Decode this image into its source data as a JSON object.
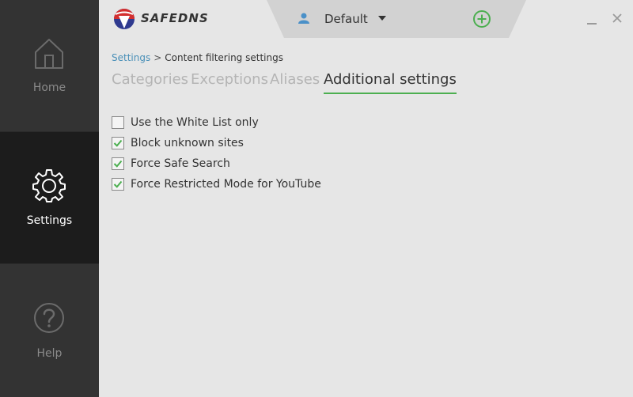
{
  "app": {
    "logo_text": "SAFEDNS"
  },
  "sidebar": {
    "items": [
      {
        "label": "Home",
        "icon": "home-icon"
      },
      {
        "label": "Settings",
        "icon": "gear-icon",
        "active": true
      },
      {
        "label": "Help",
        "icon": "help-icon"
      }
    ]
  },
  "profile": {
    "name": "Default",
    "icon": "user-icon"
  },
  "breadcrumb": {
    "root": "Settings",
    "separator": ">",
    "current": "Content filtering settings"
  },
  "tabs": [
    {
      "label": "Categories"
    },
    {
      "label": "Exceptions"
    },
    {
      "label": "Aliases"
    },
    {
      "label": "Additional settings",
      "active": true
    }
  ],
  "options": [
    {
      "label": "Use the White List only",
      "checked": false
    },
    {
      "label": "Block unknown sites",
      "checked": true
    },
    {
      "label": "Force Safe Search",
      "checked": true
    },
    {
      "label": "Force Restricted Mode for YouTube",
      "checked": true
    }
  ],
  "colors": {
    "accent": "#4caf50",
    "link": "#4a90b8",
    "sidebar": "#333333",
    "sidebar_active": "#1c1c1c"
  }
}
